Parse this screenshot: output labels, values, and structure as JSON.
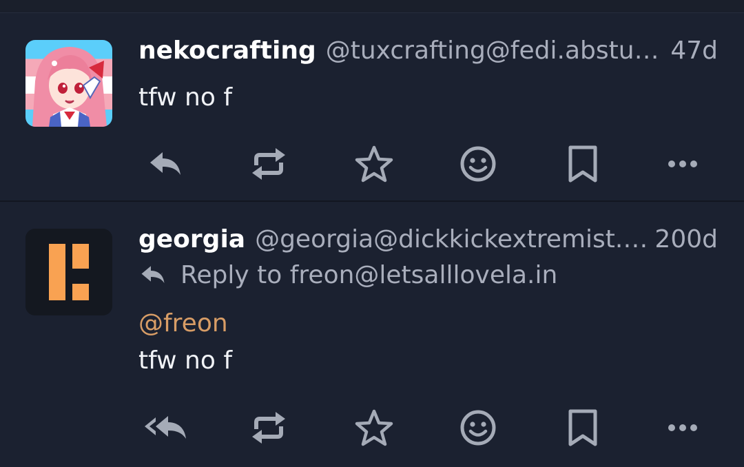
{
  "posts": [
    {
      "name": "nekocrafting",
      "handle": "@tuxcrafting@fedi.absturztau.be",
      "time": "47d",
      "text": "tfw no f",
      "avatar_icon": "anime-girl-avatar",
      "actions": [
        "reply-icon",
        "boost-icon",
        "favourite-icon",
        "emoji-react-icon",
        "bookmark-icon",
        "more-icon"
      ]
    },
    {
      "name": "georgia",
      "handle": "@georgia@dickkickextremist.xyz",
      "time": "200d",
      "reply_to": "Reply to freon@letsalllovela.in",
      "mention": "@freon",
      "text": "tfw no f",
      "avatar_icon": "pleroma-logo",
      "actions": [
        "reply-all-icon",
        "boost-icon",
        "favourite-icon",
        "emoji-react-icon",
        "bookmark-icon",
        "more-icon"
      ]
    }
  ],
  "colors": {
    "background": "#1b2130",
    "name": "#ffffff",
    "muted": "#a9aebc",
    "mention": "#d89d66",
    "icon": "#a5abb7",
    "pleroma_orange": "#f9a252"
  }
}
